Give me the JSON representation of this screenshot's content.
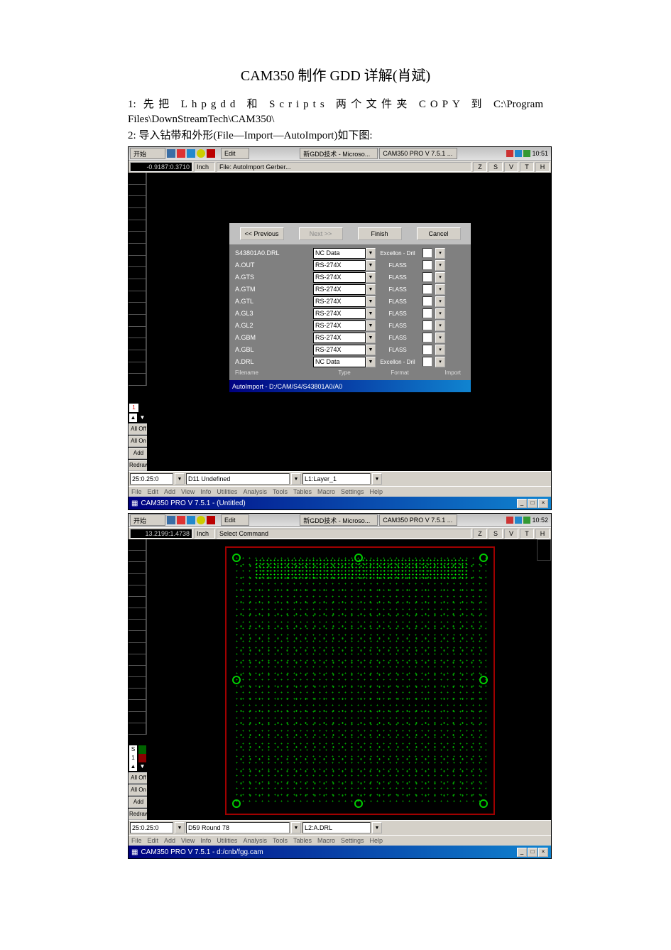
{
  "title": "CAM350 制作 GDD 详解(肖斌)",
  "step1": "1: 先把 Lhpgdd 和 Scripts 两个文件夹 COPY 到 C:\\Program Files\\DownStreamTech\\CAM350\\",
  "step2": "2: 导入钻带和外形(File—Import—AutoImport)如下图:",
  "taskbar": {
    "start": "开始",
    "task1": "新GDD技术 - Microso...",
    "task2": "CAM350 PRO V 7.5.1 ...",
    "time1": "10:51",
    "time2": "10:52"
  },
  "s1": {
    "coord": "-0.9187:0.3710",
    "unit": "Inch",
    "cmd": "File: AutoImport Gerber...",
    "ruler_letters": [
      "Z",
      "S",
      "V",
      "T",
      "H"
    ],
    "dialog": {
      "btn_prev": "<< Previous",
      "btn_next": "Next >>",
      "btn_finish": "Finish",
      "btn_cancel": "Cancel",
      "hdr": [
        "Filename",
        "Type",
        "Format",
        "Import"
      ],
      "rows": [
        {
          "fn": "S43801A0.DRL",
          "type": "NC Data",
          "fmt": "Excellon - Dril"
        },
        {
          "fn": "A.OUT",
          "type": "RS-274X",
          "fmt": "FLASS"
        },
        {
          "fn": "A.GTS",
          "type": "RS-274X",
          "fmt": "FLASS"
        },
        {
          "fn": "A.GTM",
          "type": "RS-274X",
          "fmt": "FLASS"
        },
        {
          "fn": "A.GTL",
          "type": "RS-274X",
          "fmt": "FLASS"
        },
        {
          "fn": "A.GL3",
          "type": "RS-274X",
          "fmt": "FLASS"
        },
        {
          "fn": "A.GL2",
          "type": "RS-274X",
          "fmt": "FLASS"
        },
        {
          "fn": "A.GBM",
          "type": "RS-274X",
          "fmt": "FLASS"
        },
        {
          "fn": "A.GBL",
          "type": "RS-274X",
          "fmt": "FLASS"
        },
        {
          "fn": "A.DRL",
          "type": "NC Data",
          "fmt": "Excellon - Dril"
        }
      ],
      "title": "AutoImport - D:/CAM/S4/S43801A0/A0"
    },
    "side": {
      "one": "1",
      "alloff": "All Off",
      "allon": "All On",
      "addlyr": "Add Lyr",
      "redraw": "Redraw"
    },
    "bottom": {
      "grid": "25:0.25:0",
      "dcode": "D11 Undefined",
      "layer": "L1:Layer_1"
    },
    "menu": [
      "File",
      "Edit",
      "Add",
      "View",
      "Info",
      "Utilities",
      "Analysis",
      "Tools",
      "Tables",
      "Macro",
      "Settings",
      "Help"
    ],
    "wintitle": "CAM350 PRO V 7.5.1 - (Untitled)"
  },
  "s2": {
    "coord": "13.2199:1.4738",
    "unit": "Inch",
    "cmd": "Select Command",
    "edit": "Edit",
    "side": {
      "s": "S",
      "one": "1",
      "alloff": "All Off",
      "allon": "All On",
      "addlyr": "Add Lyr",
      "redraw": "Redraw"
    },
    "bottom": {
      "grid": "25:0.25:0",
      "dcode": "D59 Round 78",
      "layer": "L2:A.DRL"
    },
    "menu": [
      "File",
      "Edit",
      "Add",
      "View",
      "Info",
      "Utilities",
      "Analysis",
      "Tools",
      "Tables",
      "Macro",
      "Settings",
      "Help"
    ],
    "wintitle": "CAM350 PRO V 7.5.1 - d:/cnb/fgg.cam"
  }
}
